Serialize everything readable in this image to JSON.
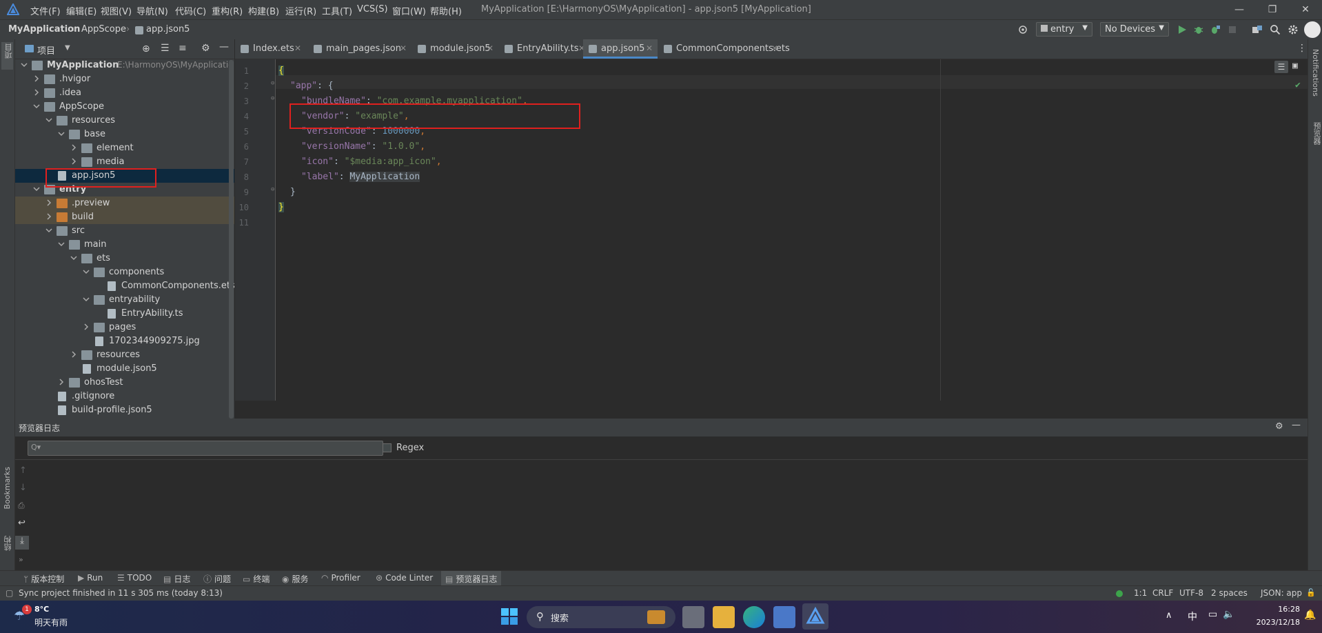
{
  "titlebar": {
    "menu": [
      "文件(F)",
      "编辑(E)",
      "视图(V)",
      "导航(N)",
      "代码(C)",
      "重构(R)",
      "构建(B)",
      "运行(R)",
      "工具(T)",
      "VCS(S)",
      "窗口(W)",
      "帮助(H)"
    ],
    "window_title": "MyApplication [E:\\HarmonyOS\\MyApplication] - app.json5 [MyApplication]"
  },
  "navbar": {
    "breadcrumbs": [
      "MyApplication",
      "AppScope",
      "app.json5"
    ],
    "run_config": "entry",
    "device": "No Devices"
  },
  "project_panel": {
    "title": "项目",
    "tree": [
      {
        "label": "MyApplication",
        "path": "E:\\HarmonyOS\\MyApplicatio",
        "depth": 0,
        "type": "module",
        "expanded": true
      },
      {
        "label": ".hvigor",
        "depth": 1,
        "type": "folder",
        "expanded": false
      },
      {
        "label": ".idea",
        "depth": 1,
        "type": "folder",
        "expanded": false
      },
      {
        "label": "AppScope",
        "depth": 1,
        "type": "folder",
        "expanded": true
      },
      {
        "label": "resources",
        "depth": 2,
        "type": "folder",
        "expanded": true
      },
      {
        "label": "base",
        "depth": 3,
        "type": "folder",
        "expanded": true
      },
      {
        "label": "element",
        "depth": 4,
        "type": "folder",
        "expanded": false
      },
      {
        "label": "media",
        "depth": 4,
        "type": "folder",
        "expanded": false
      },
      {
        "label": "app.json5",
        "depth": 2,
        "type": "file",
        "selected": true
      },
      {
        "label": "entry",
        "depth": 1,
        "type": "module",
        "expanded": true
      },
      {
        "label": ".preview",
        "depth": 2,
        "type": "folder-orange",
        "expanded": false
      },
      {
        "label": "build",
        "depth": 2,
        "type": "folder-orange",
        "expanded": false
      },
      {
        "label": "src",
        "depth": 2,
        "type": "folder",
        "expanded": true
      },
      {
        "label": "main",
        "depth": 3,
        "type": "folder",
        "expanded": true
      },
      {
        "label": "ets",
        "depth": 4,
        "type": "folder",
        "expanded": true
      },
      {
        "label": "components",
        "depth": 5,
        "type": "folder",
        "expanded": true
      },
      {
        "label": "CommonComponents.ets",
        "depth": 6,
        "type": "file"
      },
      {
        "label": "entryability",
        "depth": 5,
        "type": "folder",
        "expanded": true
      },
      {
        "label": "EntryAbility.ts",
        "depth": 6,
        "type": "file"
      },
      {
        "label": "pages",
        "depth": 5,
        "type": "folder",
        "expanded": false
      },
      {
        "label": "1702344909275.jpg",
        "depth": 5,
        "type": "file"
      },
      {
        "label": "resources",
        "depth": 4,
        "type": "folder",
        "expanded": false
      },
      {
        "label": "module.json5",
        "depth": 4,
        "type": "file"
      },
      {
        "label": "ohosTest",
        "depth": 3,
        "type": "folder",
        "expanded": false
      },
      {
        "label": ".gitignore",
        "depth": 2,
        "type": "file"
      },
      {
        "label": "build-profile.json5",
        "depth": 2,
        "type": "file"
      }
    ]
  },
  "editor": {
    "tabs": [
      {
        "label": "Index.ets",
        "active": false
      },
      {
        "label": "main_pages.json",
        "active": false
      },
      {
        "label": "module.json5",
        "active": false
      },
      {
        "label": "EntryAbility.ts",
        "active": false
      },
      {
        "label": "app.json5",
        "active": true
      },
      {
        "label": "CommonComponents.ets",
        "active": false
      }
    ],
    "line_numbers": [
      "1",
      "2",
      "3",
      "4",
      "5",
      "6",
      "7",
      "8",
      "9",
      "10",
      "11"
    ],
    "code": {
      "l1": "{",
      "l2_key": "\"app\"",
      "l2_rest": ": {",
      "l3_key": "\"bundleName\"",
      "l3_val": "\"com.example.myapplication\"",
      "l4_key": "\"vendor\"",
      "l4_val": "\"example\"",
      "l5_key": "\"versionCode\"",
      "l5_val": "1000000",
      "l6_key": "\"versionName\"",
      "l6_val": "\"1.0.0\"",
      "l7_key": "\"icon\"",
      "l7_val": "\"$media:app_icon\"",
      "l8_key": "\"label\"",
      "l8_val": "MyApplication",
      "l9": "}",
      "l10": "}",
      "colon": ": ",
      "comma": ","
    }
  },
  "bottom_panel": {
    "title": "预览器日志",
    "search_placeholder": "Q▾",
    "regex_label": "Regex"
  },
  "left_stripe": {
    "bookmarks": "Bookmarks",
    "project": "项目",
    "structure": "结构"
  },
  "right_stripe": {
    "notifications": "Notifications",
    "preview": "预览器"
  },
  "tool_windows": [
    "版本控制",
    "Run",
    "TODO",
    "日志",
    "问题",
    "终端",
    "服务",
    "Profiler",
    "Code Linter",
    "预览器日志"
  ],
  "statusbar": {
    "message": "Sync project finished in 11 s 305 ms (today 8:13)",
    "position": "1:1",
    "line_sep": "CRLF",
    "encoding": "UTF-8",
    "indent": "2 spaces",
    "file_type": "JSON: app"
  },
  "taskbar": {
    "weather_temp": "8°C",
    "weather_desc": "明天有雨",
    "weather_badge": "1",
    "search_label": "搜索",
    "ime": "中",
    "time": "16:28",
    "date": "2023/12/18"
  }
}
